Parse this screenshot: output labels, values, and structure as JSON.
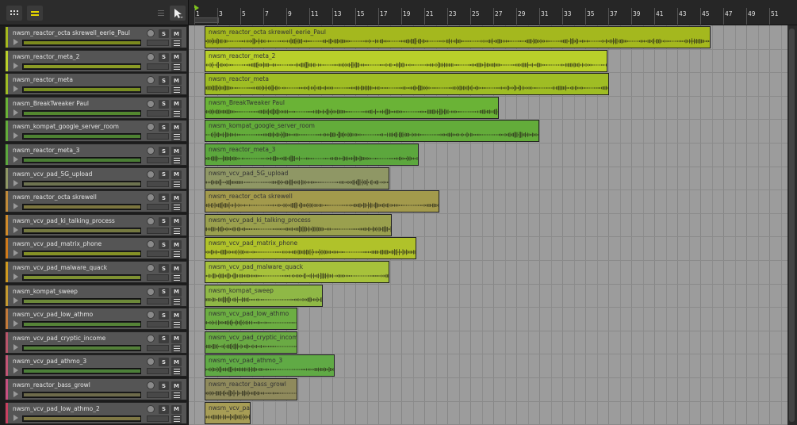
{
  "toolbar": {
    "grid_icon": "grid-icon",
    "list_icon": "list-icon",
    "menu_icon": "menu-icon",
    "pointer_icon": "pointer-tool-icon",
    "accent": "#e5d600"
  },
  "ruler": {
    "labels": [
      "1",
      "3",
      "5",
      "7",
      "9",
      "11",
      "13",
      "15",
      "17",
      "19",
      "21",
      "23",
      "25",
      "27",
      "29",
      "31",
      "33",
      "35",
      "37",
      "39",
      "41",
      "43",
      "45",
      "47",
      "49",
      "51"
    ]
  },
  "tracks": [
    {
      "name": "nwsm_reactor_octa skrewell_eerie_Paul",
      "color": "#a4b81e",
      "clip_color": "#a4b81e",
      "clip_name": "nwsm_reactor_octa skrewell_eerie_Paul",
      "start": 1,
      "len": 44
    },
    {
      "name": "nwsm_reactor_meta_2",
      "color": "#b9d02a",
      "clip_color": "#b9d02a",
      "clip_name": "nwsm_reactor_meta_2",
      "start": 1,
      "len": 35
    },
    {
      "name": "nwsm_reactor_meta",
      "color": "#9fbd24",
      "clip_color": "#9fbd24",
      "clip_name": "nwsm_reactor_meta",
      "start": 1,
      "len": 35.2
    },
    {
      "name": "nwsm_BreakTweaker Paul",
      "color": "#6ab336",
      "clip_color": "#6ab336",
      "clip_name": "nwsm_BreakTweaker Paul",
      "start": 1,
      "len": 25.6
    },
    {
      "name": "nwsm_kompat_google_server_room",
      "color": "#63ac3a",
      "clip_color": "#63ac3a",
      "clip_name": "nwsm_kompat_google_server_room",
      "start": 1,
      "len": 29.1
    },
    {
      "name": "nwsm_reactor_meta_3",
      "color": "#5ca73d",
      "clip_color": "#5ca73d",
      "clip_name": "nwsm_reactor_meta_3",
      "start": 1,
      "len": 18.6
    },
    {
      "name": "nwsm_vcv_pad_5G_upload",
      "color": "#8f9765",
      "clip_color": "#8f9765",
      "clip_name": "nwsm_vcv_pad_5G_upload",
      "start": 1,
      "len": 16.1
    },
    {
      "name": "nwsm_reactor_octa skrewell",
      "color": "#a39a4c",
      "clip_color": "#a39a4c",
      "clip_name": "nwsm_reactor_octa skrewell",
      "start": 1,
      "len": 20.4
    },
    {
      "name": "nwsm_vcv_pad_ki_talking_process",
      "color": "#9aa04e",
      "clip_color": "#9aa04e",
      "clip_name": "nwsm_vcv_pad_ki_talking_process",
      "start": 1,
      "len": 16.3
    },
    {
      "name": "nwsm_vcv_pad_matrix_phone",
      "color": "#b0c22a",
      "clip_color": "#b0c22a",
      "clip_name": "nwsm_vcv_pad_matrix_phone",
      "start": 1,
      "len": 18.4
    },
    {
      "name": "nwsm_vcv_pad_malware_quack",
      "color": "#a7c23b",
      "clip_color": "#a7c23b",
      "clip_name": "nwsm_vcv_pad_malware_quack",
      "start": 1,
      "len": 16.1
    },
    {
      "name": "nwsm_kompat_sweep",
      "color": "#8fb846",
      "clip_color": "#8fb846",
      "clip_name": "nwsm_kompat_sweep",
      "start": 1,
      "len": 10.3
    },
    {
      "name": "nwsm_vcv_pad_low_athmo",
      "color": "#6cae42",
      "clip_color": "#6cae42",
      "clip_name": "nwsm_vcv_pad_low_athmo",
      "start": 1,
      "len": 8.1
    },
    {
      "name": "nwsm_vcv_pad_cryptic_income",
      "color": "#6aaa44",
      "clip_color": "#6aaa44",
      "clip_name": "nwsm_vcv_pad_cryptic_income",
      "start": 1,
      "len": 8.1
    },
    {
      "name": "nwsm_vcv_pad_athmo_3",
      "color": "#60aa45",
      "clip_color": "#60aa45",
      "clip_name": "nwsm_vcv_pad_athmo_3",
      "start": 1,
      "len": 11.3
    },
    {
      "name": "nwsm_reactor_bass_growl",
      "color": "#8f8a5c",
      "clip_color": "#8f8a5c",
      "clip_name": "nwsm_reactor_bass_growl",
      "start": 1,
      "len": 8.1
    },
    {
      "name": "nwsm_vcv_pad_low_athmo_2",
      "color": "#a79d55",
      "clip_color": "#a79d55",
      "clip_name": "nwsm_vcv_pad_",
      "start": 1,
      "len": 4
    }
  ],
  "track_labels": {
    "solo": "S",
    "mute": "M"
  },
  "track_bar_colors": [
    "#a4b81e",
    "#b9d02a",
    "#9fbd24",
    "#6ab336",
    "#63ac3a",
    "#5ca73d",
    "#8f9765",
    "#c08a3a",
    "#d08a2a",
    "#d07a1a",
    "#d09a20",
    "#c49a30",
    "#c27a3a",
    "#b8556a",
    "#c25575",
    "#c65080",
    "#c84060"
  ]
}
